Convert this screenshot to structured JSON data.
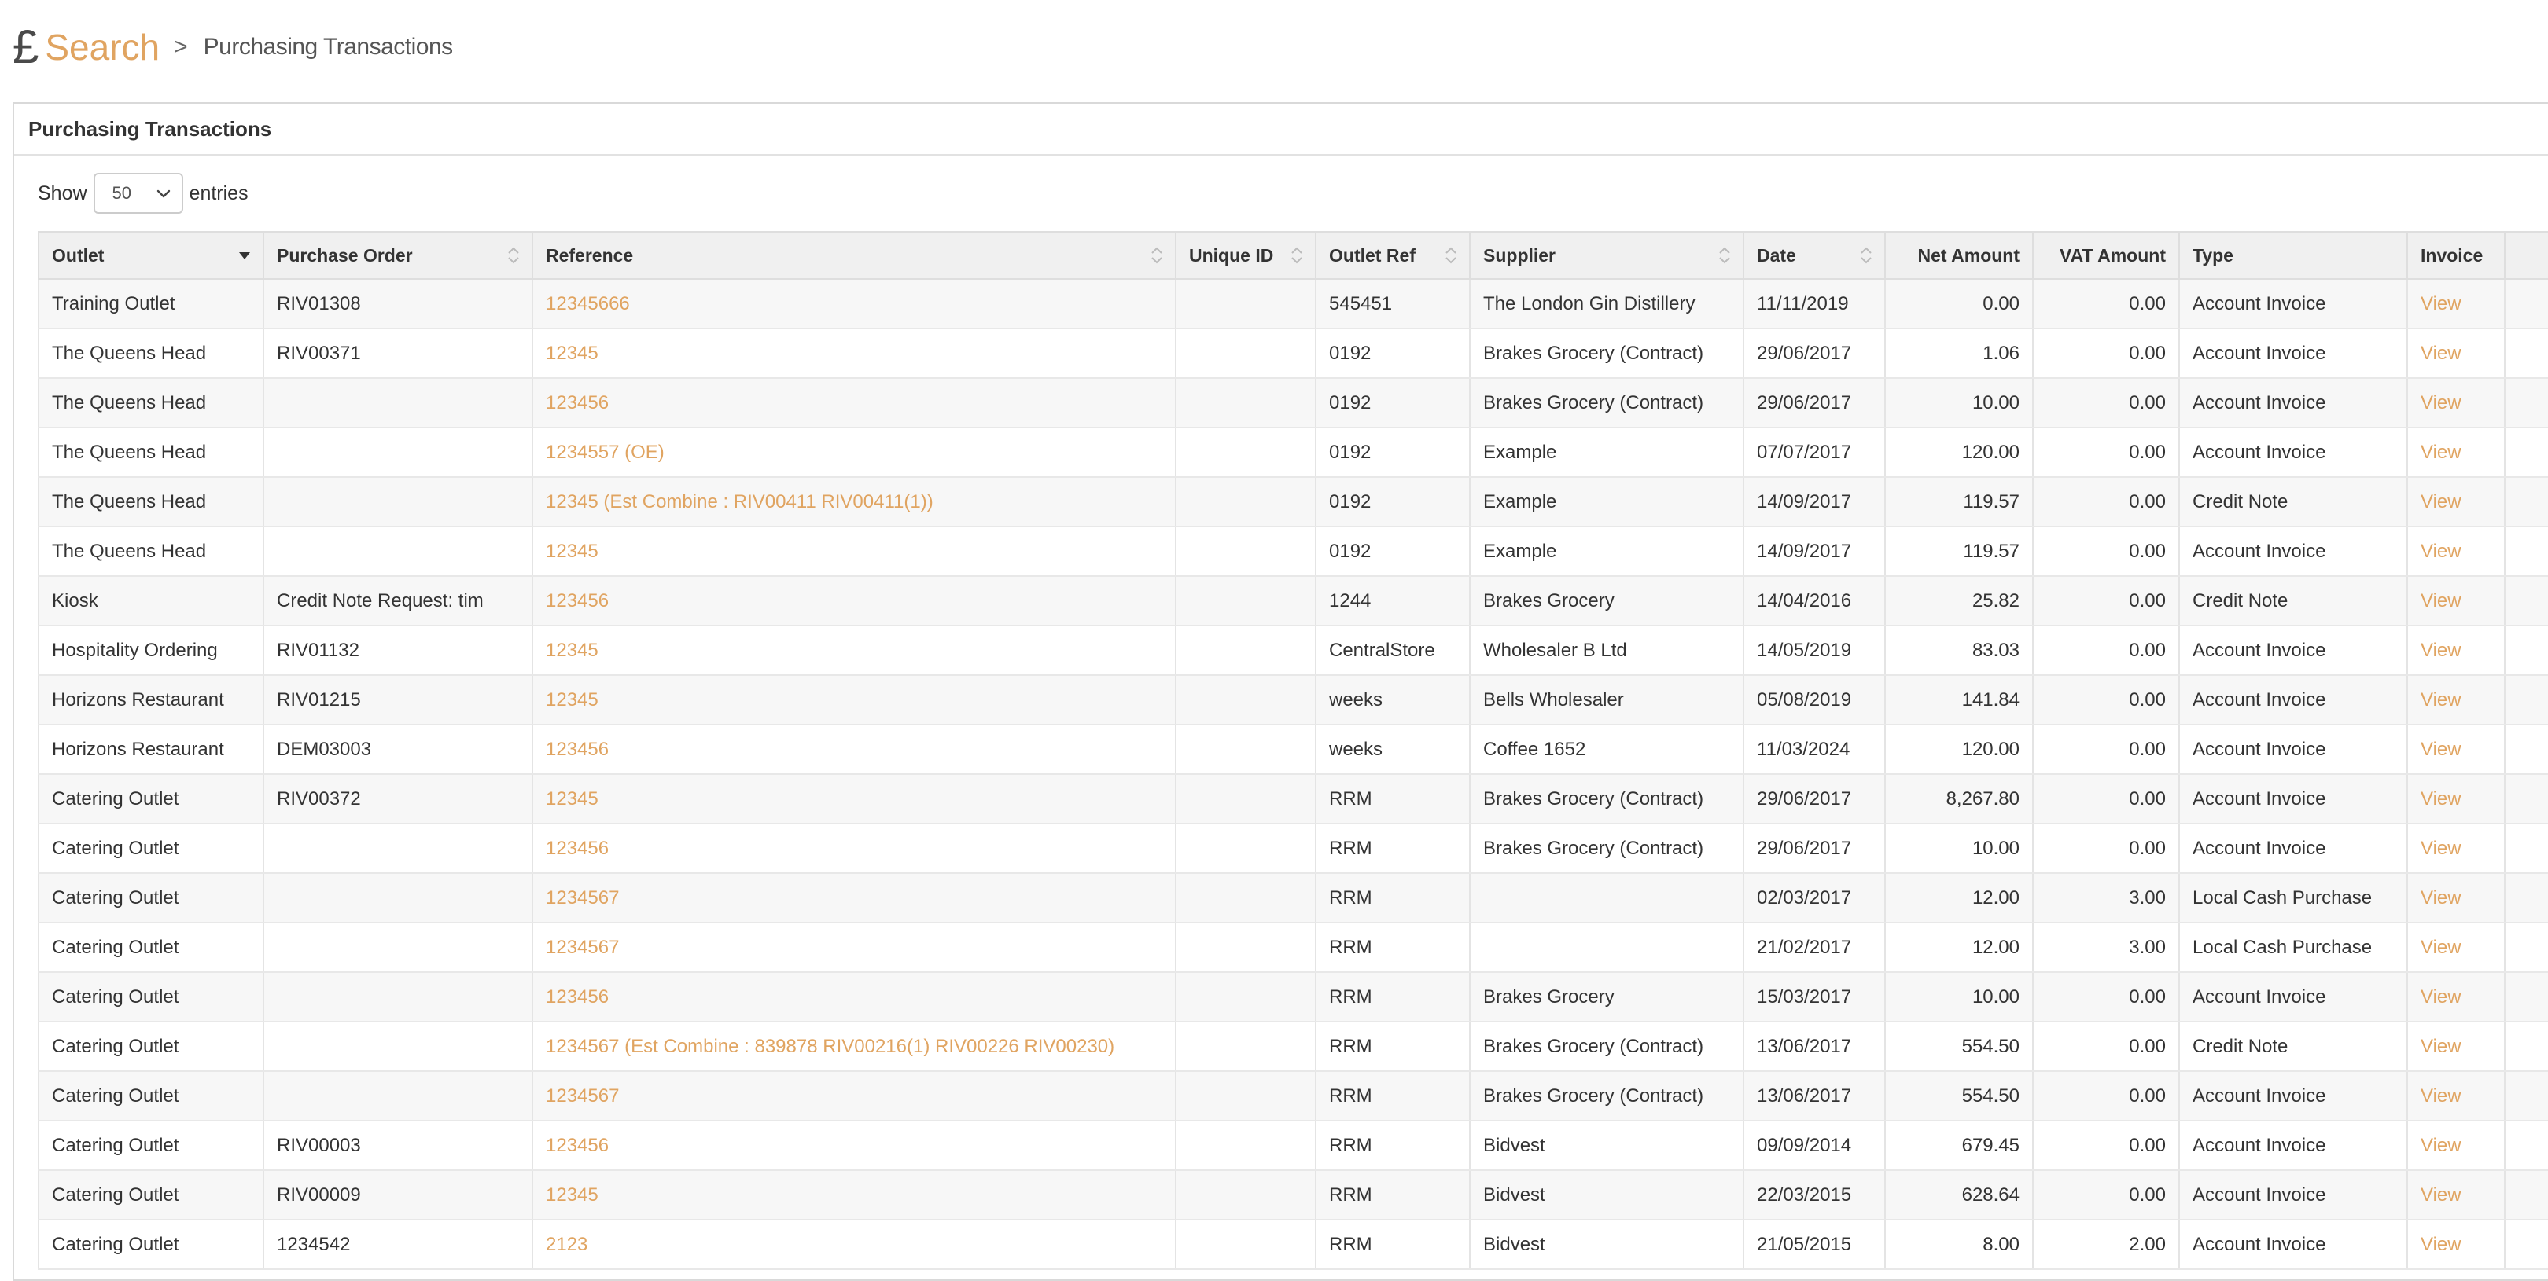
{
  "breadcrumb": {
    "icon": "pound-sign-icon",
    "search_label": "Search",
    "separator": ">",
    "current": "Purchasing Transactions"
  },
  "panel": {
    "title": "Purchasing Transactions"
  },
  "length_menu": {
    "show_label": "Show",
    "selected": "50",
    "entries_label": "entries"
  },
  "colors": {
    "accent": "#e0a461",
    "header_bg": "#f0f0f0",
    "stripe": "#f7f7f7"
  },
  "table": {
    "columns": [
      {
        "key": "outlet",
        "label": "Outlet",
        "sort": "desc"
      },
      {
        "key": "po",
        "label": "Purchase Order",
        "sort": "none"
      },
      {
        "key": "reference",
        "label": "Reference",
        "sort": "none"
      },
      {
        "key": "unique_id",
        "label": "Unique ID",
        "sort": "none"
      },
      {
        "key": "outlet_ref",
        "label": "Outlet Ref",
        "sort": "none"
      },
      {
        "key": "supplier",
        "label": "Supplier",
        "sort": "none"
      },
      {
        "key": "date",
        "label": "Date",
        "sort": "none"
      },
      {
        "key": "net",
        "label": "Net Amount",
        "sort": ""
      },
      {
        "key": "vat",
        "label": "VAT Amount",
        "sort": ""
      },
      {
        "key": "type",
        "label": "Type",
        "sort": ""
      },
      {
        "key": "invoice",
        "label": "Invoice",
        "sort": ""
      }
    ],
    "rows": [
      {
        "outlet": "Training Outlet",
        "po": "RIV01308",
        "reference": "12345666",
        "unique_id": "",
        "outlet_ref": "545451",
        "supplier": "The London Gin Distillery",
        "date": "11/11/2019",
        "net": "0.00",
        "vat": "0.00",
        "type": "Account Invoice",
        "invoice": "View"
      },
      {
        "outlet": "The Queens Head",
        "po": "RIV00371",
        "reference": "12345",
        "unique_id": "",
        "outlet_ref": "0192",
        "supplier": "Brakes Grocery (Contract)",
        "date": "29/06/2017",
        "net": "1.06",
        "vat": "0.00",
        "type": "Account Invoice",
        "invoice": "View"
      },
      {
        "outlet": "The Queens Head",
        "po": "",
        "reference": "123456",
        "unique_id": "",
        "outlet_ref": "0192",
        "supplier": "Brakes Grocery (Contract)",
        "date": "29/06/2017",
        "net": "10.00",
        "vat": "0.00",
        "type": "Account Invoice",
        "invoice": "View"
      },
      {
        "outlet": "The Queens Head",
        "po": "",
        "reference": "1234557 (OE)",
        "unique_id": "",
        "outlet_ref": "0192",
        "supplier": "Example",
        "date": "07/07/2017",
        "net": "120.00",
        "vat": "0.00",
        "type": "Account Invoice",
        "invoice": "View"
      },
      {
        "outlet": "The Queens Head",
        "po": "",
        "reference": "12345 (Est Combine : RIV00411 RIV00411(1))",
        "unique_id": "",
        "outlet_ref": "0192",
        "supplier": "Example",
        "date": "14/09/2017",
        "net": "119.57",
        "vat": "0.00",
        "type": "Credit Note",
        "invoice": "View"
      },
      {
        "outlet": "The Queens Head",
        "po": "",
        "reference": "12345",
        "unique_id": "",
        "outlet_ref": "0192",
        "supplier": "Example",
        "date": "14/09/2017",
        "net": "119.57",
        "vat": "0.00",
        "type": "Account Invoice",
        "invoice": "View"
      },
      {
        "outlet": "Kiosk",
        "po": "Credit Note Request: tim",
        "reference": "123456",
        "unique_id": "",
        "outlet_ref": "1244",
        "supplier": "Brakes Grocery",
        "date": "14/04/2016",
        "net": "25.82",
        "vat": "0.00",
        "type": "Credit Note",
        "invoice": "View"
      },
      {
        "outlet": "Hospitality Ordering",
        "po": "RIV01132",
        "reference": "12345",
        "unique_id": "",
        "outlet_ref": "CentralStore",
        "supplier": "Wholesaler B Ltd",
        "date": "14/05/2019",
        "net": "83.03",
        "vat": "0.00",
        "type": "Account Invoice",
        "invoice": "View"
      },
      {
        "outlet": "Horizons Restaurant",
        "po": "RIV01215",
        "reference": "12345",
        "unique_id": "",
        "outlet_ref": "weeks",
        "supplier": "Bells Wholesaler",
        "date": "05/08/2019",
        "net": "141.84",
        "vat": "0.00",
        "type": "Account Invoice",
        "invoice": "View"
      },
      {
        "outlet": "Horizons Restaurant",
        "po": "DEM03003",
        "reference": "123456",
        "unique_id": "",
        "outlet_ref": "weeks",
        "supplier": "Coffee 1652",
        "date": "11/03/2024",
        "net": "120.00",
        "vat": "0.00",
        "type": "Account Invoice",
        "invoice": "View"
      },
      {
        "outlet": "Catering Outlet",
        "po": "RIV00372",
        "reference": "12345",
        "unique_id": "",
        "outlet_ref": "RRM",
        "supplier": "Brakes Grocery (Contract)",
        "date": "29/06/2017",
        "net": "8,267.80",
        "vat": "0.00",
        "type": "Account Invoice",
        "invoice": "View"
      },
      {
        "outlet": "Catering Outlet",
        "po": "",
        "reference": "123456",
        "unique_id": "",
        "outlet_ref": "RRM",
        "supplier": "Brakes Grocery (Contract)",
        "date": "29/06/2017",
        "net": "10.00",
        "vat": "0.00",
        "type": "Account Invoice",
        "invoice": "View"
      },
      {
        "outlet": "Catering Outlet",
        "po": "",
        "reference": "1234567",
        "unique_id": "",
        "outlet_ref": "RRM",
        "supplier": "",
        "date": "02/03/2017",
        "net": "12.00",
        "vat": "3.00",
        "type": "Local Cash Purchase",
        "invoice": "View"
      },
      {
        "outlet": "Catering Outlet",
        "po": "",
        "reference": "1234567",
        "unique_id": "",
        "outlet_ref": "RRM",
        "supplier": "",
        "date": "21/02/2017",
        "net": "12.00",
        "vat": "3.00",
        "type": "Local Cash Purchase",
        "invoice": "View"
      },
      {
        "outlet": "Catering Outlet",
        "po": "",
        "reference": "123456",
        "unique_id": "",
        "outlet_ref": "RRM",
        "supplier": "Brakes Grocery",
        "date": "15/03/2017",
        "net": "10.00",
        "vat": "0.00",
        "type": "Account Invoice",
        "invoice": "View"
      },
      {
        "outlet": "Catering Outlet",
        "po": "",
        "reference": "1234567 (Est Combine : 839878 RIV00216(1) RIV00226 RIV00230)",
        "unique_id": "",
        "outlet_ref": "RRM",
        "supplier": "Brakes Grocery (Contract)",
        "date": "13/06/2017",
        "net": "554.50",
        "vat": "0.00",
        "type": "Credit Note",
        "invoice": "View"
      },
      {
        "outlet": "Catering Outlet",
        "po": "",
        "reference": "1234567",
        "unique_id": "",
        "outlet_ref": "RRM",
        "supplier": "Brakes Grocery (Contract)",
        "date": "13/06/2017",
        "net": "554.50",
        "vat": "0.00",
        "type": "Account Invoice",
        "invoice": "View"
      },
      {
        "outlet": "Catering Outlet",
        "po": "RIV00003",
        "reference": "123456",
        "unique_id": "",
        "outlet_ref": "RRM",
        "supplier": "Bidvest",
        "date": "09/09/2014",
        "net": "679.45",
        "vat": "0.00",
        "type": "Account Invoice",
        "invoice": "View"
      },
      {
        "outlet": "Catering Outlet",
        "po": "RIV00009",
        "reference": "12345",
        "unique_id": "",
        "outlet_ref": "RRM",
        "supplier": "Bidvest",
        "date": "22/03/2015",
        "net": "628.64",
        "vat": "0.00",
        "type": "Account Invoice",
        "invoice": "View"
      },
      {
        "outlet": "Catering Outlet",
        "po": "1234542",
        "reference": "2123",
        "unique_id": "",
        "outlet_ref": "RRM",
        "supplier": "Bidvest",
        "date": "21/05/2015",
        "net": "8.00",
        "vat": "2.00",
        "type": "Account Invoice",
        "invoice": "View"
      }
    ]
  }
}
